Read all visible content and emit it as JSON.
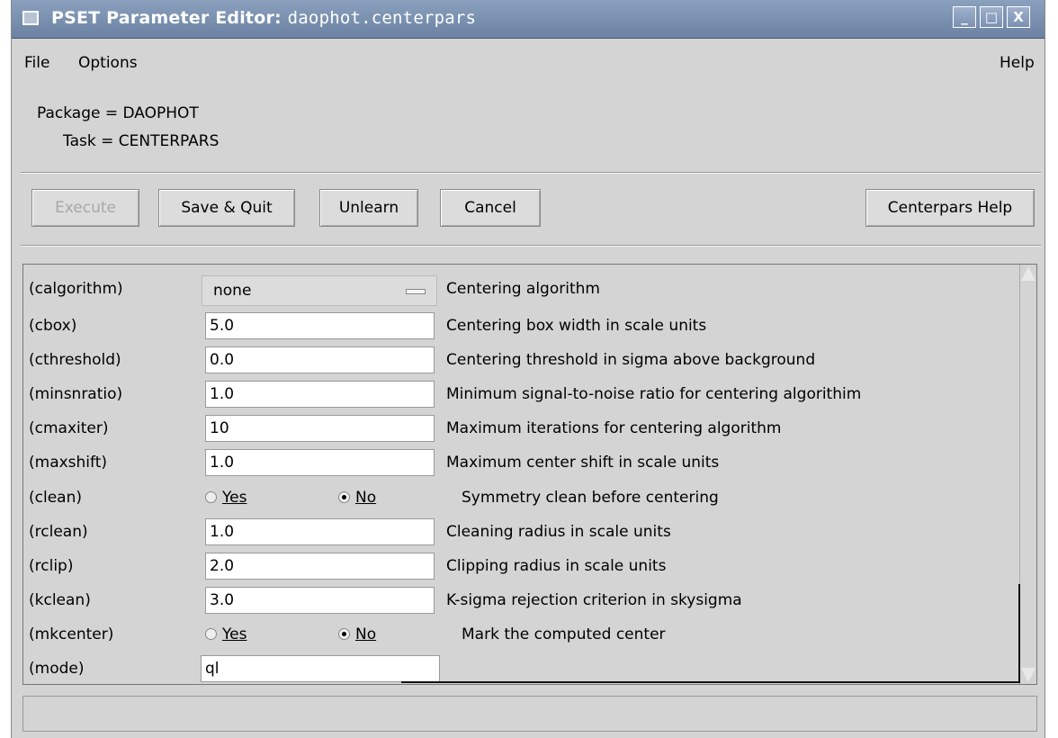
{
  "window": {
    "title_prefix": "PSET Parameter Editor:",
    "title_task": "daophot.centerpars",
    "controls": {
      "minimize": "_",
      "maximize": "□",
      "close": "X"
    }
  },
  "menu": {
    "file": "File",
    "options": "Options",
    "help": "Help"
  },
  "header": {
    "package_line": "Package = DAOPHOT",
    "task_line": "Task = CENTERPARS"
  },
  "buttons": {
    "execute": "Execute",
    "save_quit": "Save & Quit",
    "unlearn": "Unlearn",
    "cancel": "Cancel",
    "help": "Centerpars Help"
  },
  "params": [
    {
      "name": "(calgorithm)",
      "type": "select",
      "value": "none",
      "desc": "Centering algorithm"
    },
    {
      "name": "(cbox)",
      "type": "text",
      "value": "5.0",
      "desc": "Centering box width in scale units"
    },
    {
      "name": "(cthreshold)",
      "type": "text",
      "value": "0.0",
      "desc": "Centering threshold in sigma above background"
    },
    {
      "name": "(minsnratio)",
      "type": "text",
      "value": "1.0",
      "desc": "Minimum signal-to-noise ratio for centering algorithim"
    },
    {
      "name": "(cmaxiter)",
      "type": "text",
      "value": "10",
      "desc": "Maximum iterations for centering algorithm"
    },
    {
      "name": "(maxshift)",
      "type": "text",
      "value": "1.0",
      "desc": "Maximum center shift in scale units"
    },
    {
      "name": "(clean)",
      "type": "bool",
      "yes": "Yes",
      "no": "No",
      "selected": "No",
      "desc": "Symmetry clean before centering"
    },
    {
      "name": "(rclean)",
      "type": "text",
      "value": "1.0",
      "desc": "Cleaning radius in scale units"
    },
    {
      "name": "(rclip)",
      "type": "text",
      "value": "2.0",
      "desc": "Clipping radius in scale units"
    },
    {
      "name": "(kclean)",
      "type": "text",
      "value": "3.0",
      "desc": "K-sigma rejection criterion in skysigma"
    },
    {
      "name": "(mkcenter)",
      "type": "bool",
      "yes": "Yes",
      "no": "No",
      "selected": "No",
      "desc": "Mark the computed center"
    },
    {
      "name": "(mode)",
      "type": "text",
      "value": "ql",
      "desc": ""
    }
  ],
  "status_text": ""
}
